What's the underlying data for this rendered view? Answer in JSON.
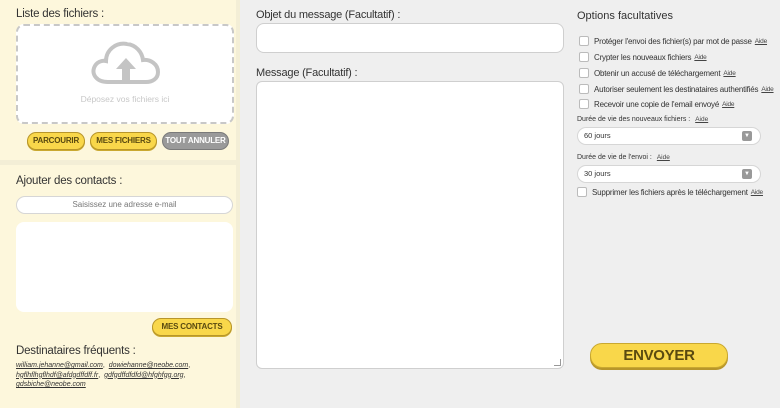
{
  "files": {
    "title": "Liste des fichiers :",
    "drop_text": "Déposez vos fichiers ici",
    "btn_browse": "PARCOURIR",
    "btn_my_files": "MES FICHIERS",
    "btn_cancel_all": "TOUT ANNULER"
  },
  "contacts": {
    "title": "Ajouter des contacts :",
    "email_placeholder": "Saisissez une adresse e-mail",
    "btn_my_contacts": "MES CONTACTS",
    "frequent_title": "Destinataires fréquents :",
    "frequent": [
      "william.jehanne@gmail.com",
      "dowiehanne@neobe.com",
      "hgflhflhgflhdf@afdgdffdff.fr",
      "gdfgdffdfdfd@hfghfgg.org",
      "gdsbiche@neobe.com"
    ]
  },
  "message": {
    "subject_label": "Objet du message (Facultatif) :",
    "body_label": "Message (Facultatif) :"
  },
  "options": {
    "title": "Options facultatives",
    "aide": "Aide",
    "checkboxes": [
      "Protéger l'envoi des fichier(s) par mot de passe",
      "Crypter les nouveaux fichiers",
      "Obtenir un accusé de téléchargement",
      "Autoriser seulement les destinataires authentifiés",
      "Recevoir une copie de l'email envoyé"
    ],
    "lifetime_new_label": "Durée de vie des nouveaux fichiers :",
    "lifetime_new_value": "60 jours",
    "lifetime_send_label": "Durée de vie de l'envoi :",
    "lifetime_send_value": "30 jours",
    "delete_after_label": "Supprimer les fichiers après le téléchargement"
  },
  "send_label": "ENVOYER",
  "colors": {
    "accent_yellow": "#f9d74a",
    "panel_bg": "#fdf7dc",
    "page_bg": "#efefef"
  }
}
